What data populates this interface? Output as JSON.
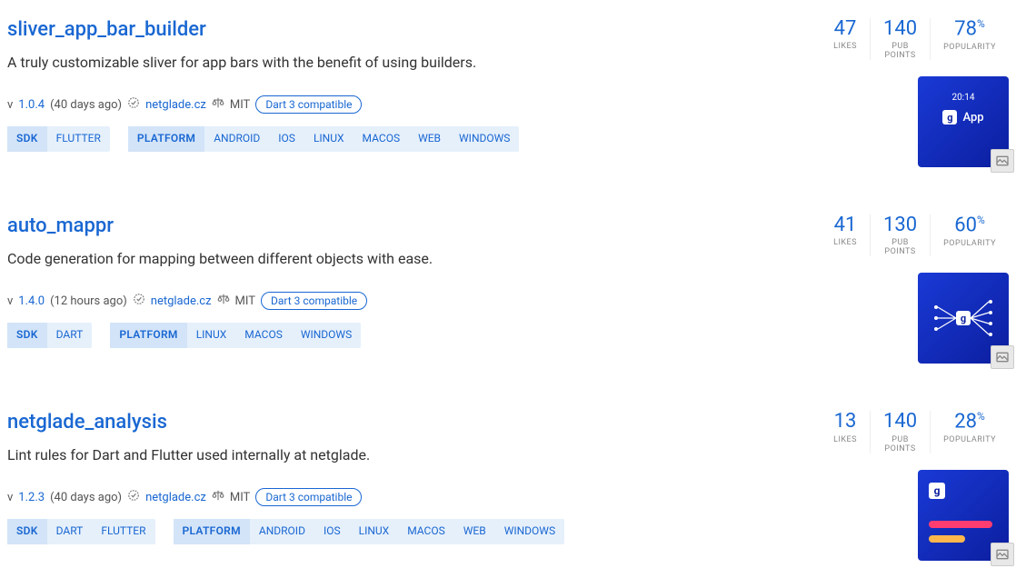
{
  "packages": [
    {
      "name": "sliver_app_bar_builder",
      "desc": "A truly customizable sliver for app bars with the benefit of using builders.",
      "version": "1.0.4",
      "age": "(40 days ago)",
      "publisher": "netglade.cz",
      "license": "MIT",
      "dart3": "Dart 3 compatible",
      "sdk_label": "SDK",
      "sdks": [
        "FLUTTER"
      ],
      "platform_label": "PLATFORM",
      "platforms": [
        "ANDROID",
        "IOS",
        "LINUX",
        "MACOS",
        "WEB",
        "WINDOWS"
      ],
      "likes": "47",
      "pubpoints": "140",
      "popularity": "78",
      "thumb": {
        "time": "20:14",
        "app": "App"
      }
    },
    {
      "name": "auto_mappr",
      "desc": "Code generation for mapping between different objects with ease.",
      "version": "1.4.0",
      "age": "(12 hours ago)",
      "publisher": "netglade.cz",
      "license": "MIT",
      "dart3": "Dart 3 compatible",
      "sdk_label": "SDK",
      "sdks": [
        "DART"
      ],
      "platform_label": "PLATFORM",
      "platforms": [
        "LINUX",
        "MACOS",
        "WINDOWS"
      ],
      "likes": "41",
      "pubpoints": "130",
      "popularity": "60"
    },
    {
      "name": "netglade_analysis",
      "desc": "Lint rules for Dart and Flutter used internally at netglade.",
      "version": "1.2.3",
      "age": "(40 days ago)",
      "publisher": "netglade.cz",
      "license": "MIT",
      "dart3": "Dart 3 compatible",
      "sdk_label": "SDK",
      "sdks": [
        "DART",
        "FLUTTER"
      ],
      "platform_label": "PLATFORM",
      "platforms": [
        "ANDROID",
        "IOS",
        "LINUX",
        "MACOS",
        "WEB",
        "WINDOWS"
      ],
      "likes": "13",
      "pubpoints": "140",
      "popularity": "28"
    }
  ],
  "labels": {
    "likes": "LIKES",
    "pubpoints": "PUB POINTS",
    "popularity": "POPULARITY",
    "version_prefix": "v"
  }
}
